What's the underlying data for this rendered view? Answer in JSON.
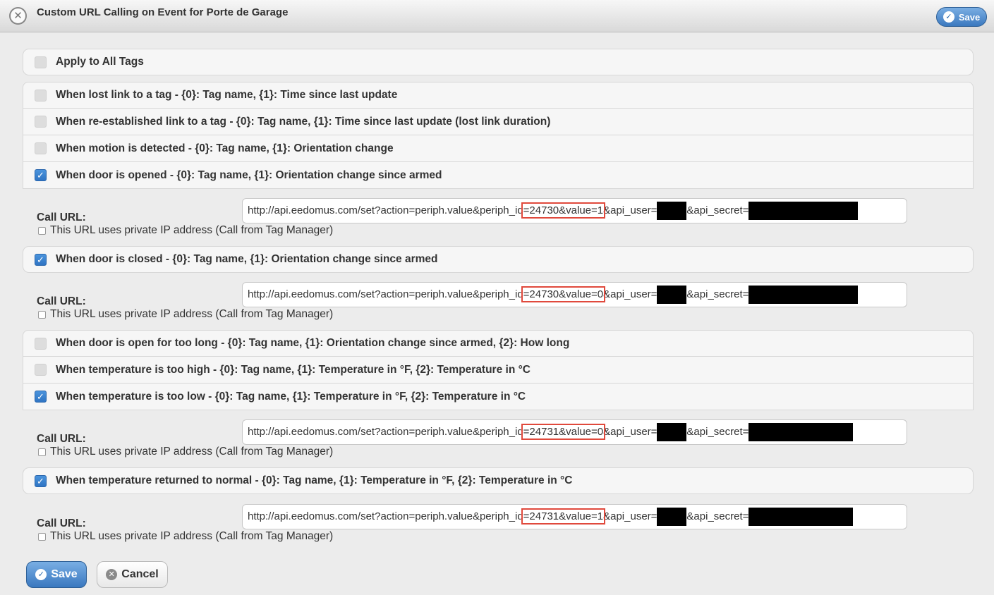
{
  "window": {
    "title": "Custom URL Calling on Event for Porte de Garage",
    "save_label": "Save"
  },
  "apply_all": {
    "label": "Apply to All Tags",
    "checked": false
  },
  "events": [
    {
      "label": "When lost link to a tag - {0}: Tag name, {1}: Time since last update",
      "checked": false
    },
    {
      "label": "When re-established link to a tag - {0}: Tag name, {1}: Time since last update (lost link duration)",
      "checked": false
    },
    {
      "label": "When motion is detected - {0}: Tag name, {1}: Orientation change",
      "checked": false
    },
    {
      "label": "When door is opened - {0}: Tag name, {1}: Orientation change since armed",
      "checked": true
    },
    {
      "label": "When door is closed - {0}: Tag name, {1}: Orientation change since armed",
      "checked": true
    },
    {
      "label": "When door is open for too long - {0}: Tag name, {1}: Orientation change since armed, {2}: How long",
      "checked": false
    },
    {
      "label": "When temperature is too high - {0}: Tag name, {1}: Temperature in °F, {2}: Temperature in °C",
      "checked": false
    },
    {
      "label": "When temperature is too low - {0}: Tag name, {1}: Temperature in °F, {2}: Temperature in °C",
      "checked": true
    },
    {
      "label": "When temperature returned to normal - {0}: Tag name, {1}: Temperature in °F, {2}: Temperature in °C",
      "checked": true
    }
  ],
  "call_url_label": "Call URL:",
  "private_ip_label": "This URL uses private IP address (Call from Tag Manager)",
  "urls": [
    {
      "prefix": "http://api.eedomus.com/set?action=periph.value&periph_id",
      "highlight": "=24730&value=1",
      "user_part": "&api_user=",
      "secret_part": "&api_secret="
    },
    {
      "prefix": "http://api.eedomus.com/set?action=periph.value&periph_id",
      "highlight": "=24730&value=0",
      "user_part": "&api_user=",
      "secret_part": "&api_secret="
    },
    {
      "prefix": "http://api.eedomus.com/set?action=periph.value&periph_id",
      "highlight": "=24731&value=0",
      "user_part": "&api_user=",
      "secret_part": "&api_secret="
    },
    {
      "prefix": "http://api.eedomus.com/set?action=periph.value&periph_id",
      "highlight": "=24731&value=1",
      "user_part": "&api_user=",
      "secret_part": "&api_secret="
    }
  ],
  "footer": {
    "save_label": "Save",
    "cancel_label": "Cancel"
  },
  "colors": {
    "accent": "#3b79bf",
    "highlight_box": "#e0493c"
  },
  "icons": {
    "close": "close-circle-icon",
    "save": "check-circle-icon",
    "cancel": "x-circle-icon"
  }
}
